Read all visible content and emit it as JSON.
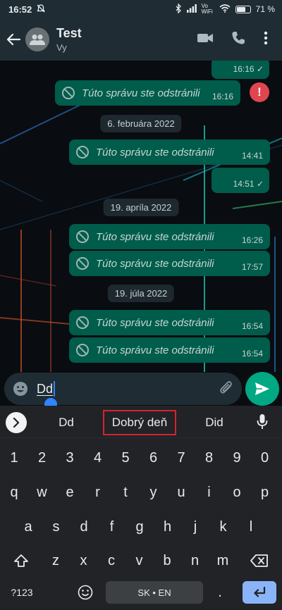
{
  "status_bar": {
    "time": "16:52",
    "battery_text": "71 %",
    "battery_level": 0.71,
    "network": "Vo WiFi"
  },
  "header": {
    "title": "Test",
    "subtitle": "Vy"
  },
  "messages": [
    {
      "text": "",
      "time": "16:16",
      "check": "✓"
    },
    {
      "text": "Túto správu ste odstránili",
      "time": "16:16"
    },
    {
      "date": "6. februára 2022"
    },
    {
      "text": "Túto správu ste odstránili",
      "time": "14:41"
    },
    {
      "text": "",
      "time": "14:51",
      "check": "✓"
    },
    {
      "date": "19. apríla 2022"
    },
    {
      "text": "Túto správu ste odstránili",
      "time": "16:26"
    },
    {
      "text": "Túto správu ste odstránili",
      "time": "17:57"
    },
    {
      "date": "19. júla 2022"
    },
    {
      "text": "Túto správu ste odstránili",
      "time": "16:54"
    },
    {
      "text": "Túto správu ste odstránili",
      "time": "16:54"
    }
  ],
  "error_badge": "!",
  "input": {
    "value": "Dd"
  },
  "keyboard": {
    "suggestions": [
      "Dd",
      "Dobrý deň",
      "Did"
    ],
    "row_numbers": [
      "1",
      "2",
      "3",
      "4",
      "5",
      "6",
      "7",
      "8",
      "9",
      "0"
    ],
    "row1": [
      "q",
      "w",
      "e",
      "r",
      "t",
      "y",
      "u",
      "i",
      "o",
      "p"
    ],
    "row2": [
      "a",
      "s",
      "d",
      "f",
      "g",
      "h",
      "j",
      "k",
      "l"
    ],
    "row3": [
      "z",
      "x",
      "c",
      "v",
      "b",
      "n",
      "m"
    ],
    "symbols_key": "?123",
    "space_label": "SK • EN",
    "period_key": "."
  },
  "colors": {
    "outgoing_bubble": "#005c4b",
    "accent": "#00a884",
    "error": "#e0464f",
    "suggestion_highlight": "#d4232e"
  }
}
